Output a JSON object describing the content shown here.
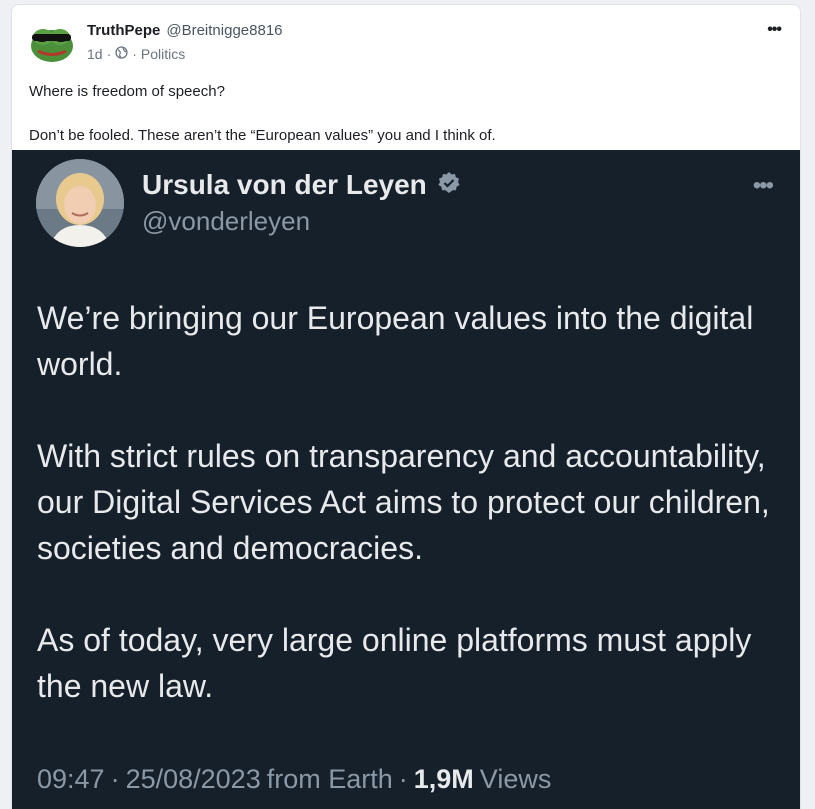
{
  "post": {
    "display_name": "TruthPepe",
    "handle": "@Breitnigge8816",
    "age": "1d",
    "separator": "·",
    "category": "Politics",
    "more_icon": "ellipsis-icon",
    "globe_icon": "globe-icon",
    "text": [
      "Where is freedom of speech?",
      "Don’t be fooled. These aren’t the “European values” you and I think of."
    ]
  },
  "embedded_tweet": {
    "name": "Ursula von der Leyen",
    "handle": "@vonderleyen",
    "verified_icon": "verified-badge-icon",
    "more_icon": "ellipsis-icon",
    "paragraphs": [
      "We’re bringing our European values into the digital world.",
      "With strict rules on transparency and accountability, our Digital Services Act aims to protect our children, societies and democracies.",
      "As of today, very large online platforms must apply the new law."
    ],
    "footer": {
      "time": "09:47",
      "sep1": "·",
      "date": "25/08/2023",
      "source": "from Earth",
      "sep2": "·",
      "views_count": "1,9M",
      "views_label": "Views"
    }
  },
  "colors": {
    "card_bg": "#ffffff",
    "page_bg": "#eef0f3",
    "tweet_bg": "#15202b",
    "tweet_text": "#e7e9ea",
    "tweet_muted": "#8b98a5"
  }
}
